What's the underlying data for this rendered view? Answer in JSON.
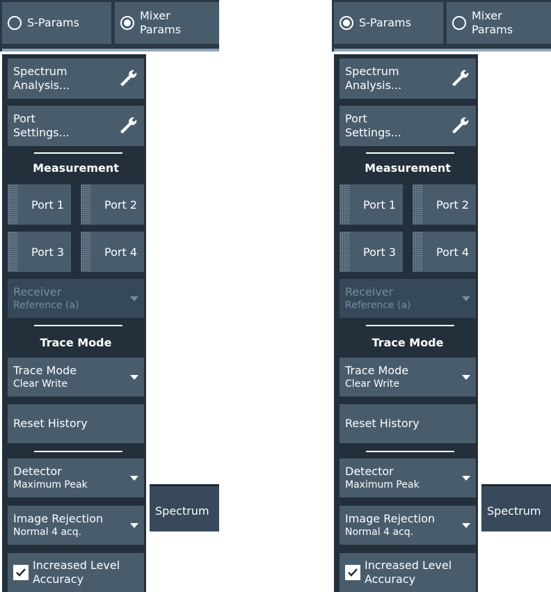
{
  "panels": [
    {
      "radio": [
        {
          "label": "S-Params",
          "checked": false
        },
        {
          "label": "Mixer\nParams",
          "checked": true
        }
      ],
      "spectrum_analysis": {
        "line1": "Spectrum",
        "line2": "Analysis..."
      },
      "port_settings": {
        "line1": "Port",
        "line2": "Settings..."
      },
      "measurement_title": "Measurement",
      "ports": [
        "Port 1",
        "Port 2",
        "Port 3",
        "Port 4"
      ],
      "receiver": {
        "label": "Receiver",
        "value": "Reference (a)"
      },
      "trace_mode_title": "Trace Mode",
      "trace_mode": {
        "label": "Trace Mode",
        "value": "Clear Write"
      },
      "reset_history": "Reset History",
      "detector": {
        "label": "Detector",
        "value": "Maximum Peak"
      },
      "image_rejection": {
        "label": "Image Rejection",
        "value": "Normal 4 acq."
      },
      "increased_level": {
        "line1": "Increased Level",
        "line2": "Accuracy",
        "checked": true
      },
      "spectrum_tab": "Spectrum"
    },
    {
      "radio": [
        {
          "label": "S-Params",
          "checked": true
        },
        {
          "label": "Mixer\nParams",
          "checked": false
        }
      ],
      "spectrum_analysis": {
        "line1": "Spectrum",
        "line2": "Analysis..."
      },
      "port_settings": {
        "line1": "Port",
        "line2": "Settings..."
      },
      "measurement_title": "Measurement",
      "ports": [
        "Port 1",
        "Port 2",
        "Port 3",
        "Port 4"
      ],
      "receiver": {
        "label": "Receiver",
        "value": "Reference (a)"
      },
      "trace_mode_title": "Trace Mode",
      "trace_mode": {
        "label": "Trace Mode",
        "value": "Clear Write"
      },
      "reset_history": "Reset History",
      "detector": {
        "label": "Detector",
        "value": "Maximum Peak"
      },
      "image_rejection": {
        "label": "Image Rejection",
        "value": "Normal 4 acq."
      },
      "increased_level": {
        "line1": "Increased Level",
        "line2": "Accuracy",
        "checked": true
      },
      "spectrum_tab": "Spectrum"
    }
  ],
  "colors": {
    "button_bg": "#485c6c",
    "panel_bg": "#23303b",
    "topbar_bg": "#2b3947",
    "disabled_text": "#7a8c9b",
    "text": "#ffffff"
  },
  "icons": {
    "wrench": "wrench-icon",
    "dropdown": "chevron-down-icon",
    "radio": "radio-icon",
    "checkbox": "checkbox-icon"
  }
}
